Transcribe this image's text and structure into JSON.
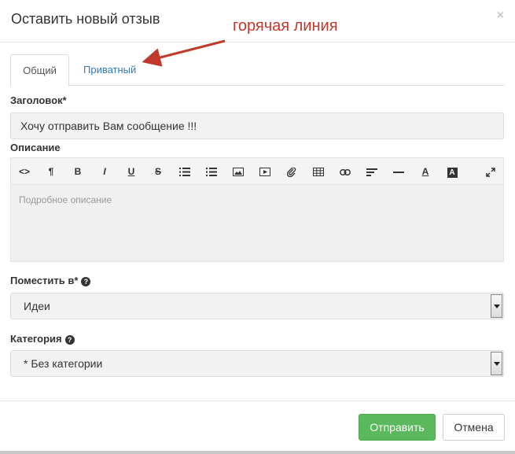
{
  "modal": {
    "title": "Оставить новый отзыв",
    "close": "×"
  },
  "annotation": {
    "text": "горячая линия",
    "color": "#c0392b"
  },
  "tabs": [
    {
      "label": "Общий",
      "active": true
    },
    {
      "label": "Приватный",
      "active": false
    }
  ],
  "subject": {
    "label": "Заголовок*",
    "value": "Хочу отправить Вам сообщение !!!"
  },
  "description": {
    "label": "Описание",
    "placeholder": "Подробное описание",
    "toolbar": [
      "code-icon",
      "paragraph-icon",
      "bold-icon",
      "italic-icon",
      "underline-icon",
      "strikethrough-icon",
      "bulleted-list-icon",
      "numbered-list-icon",
      "image-icon",
      "video-icon",
      "attachment-icon",
      "table-icon",
      "link-icon",
      "align-icon",
      "horizontal-rule-icon",
      "font-color-icon",
      "background-color-icon",
      "fullscreen-icon"
    ]
  },
  "place": {
    "label": "Поместить в*",
    "help": "?",
    "selected": "Идеи"
  },
  "category": {
    "label": "Категория",
    "help": "?",
    "selected": "* Без категории"
  },
  "footer": {
    "submit": "Отправить",
    "cancel": "Отмена"
  },
  "colors": {
    "primary": "#5cb85c",
    "link": "#337ab7"
  },
  "toolbar_glyphs": {
    "code": "<>",
    "paragraph": "¶",
    "bold": "B",
    "italic": "I",
    "underline": "U",
    "strike": "S",
    "font_color": "A",
    "bg_color": "A"
  }
}
